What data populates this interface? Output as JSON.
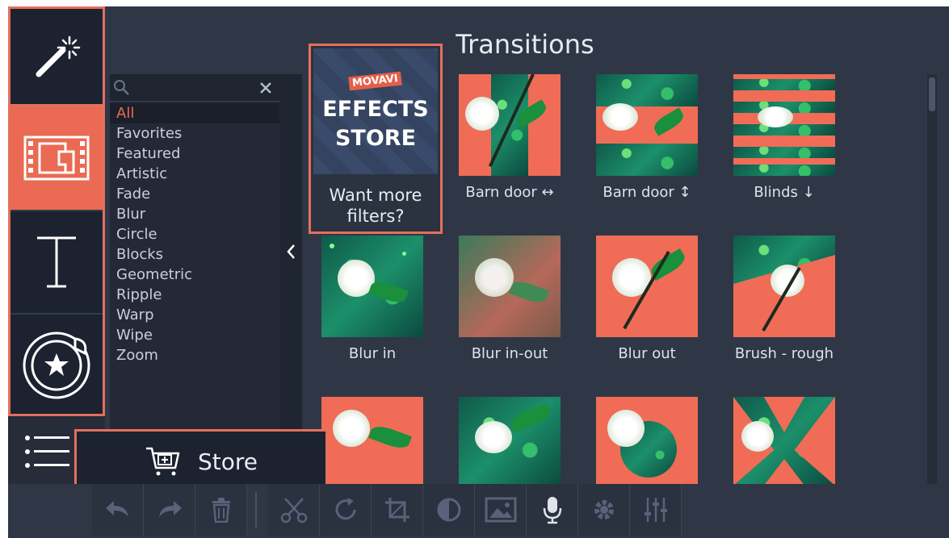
{
  "left_toolbar": {
    "tools": [
      {
        "name": "Magic wand",
        "icon": "magic-wand-icon"
      },
      {
        "name": "Filters",
        "icon": "filmstrip-icon",
        "active": true
      },
      {
        "name": "Titles",
        "icon": "text-icon"
      },
      {
        "name": "Stickers",
        "icon": "sticker-icon"
      }
    ],
    "menu_icon": "hamburger-menu-icon"
  },
  "categories": {
    "search_placeholder": "",
    "items": [
      "All",
      "Favorites",
      "Featured",
      "Artistic",
      "Fade",
      "Blur",
      "Circle",
      "Blocks",
      "Geometric",
      "Ripple",
      "Warp",
      "Wipe",
      "Zoom"
    ],
    "active_index": 0
  },
  "content": {
    "title": "Transitions",
    "store_card": {
      "brand": "MOVAVI",
      "line1": "EFFECTS",
      "line2": "STORE",
      "text": "Want more filters?"
    },
    "tiles": [
      {
        "label": "Barn door ↔"
      },
      {
        "label": "Barn door ↕"
      },
      {
        "label": "Blinds ↓"
      },
      {
        "label": "Blur in"
      },
      {
        "label": "Blur in-out"
      },
      {
        "label": "Blur out"
      },
      {
        "label": "Brush - rough"
      },
      {
        "label": ""
      },
      {
        "label": ""
      },
      {
        "label": ""
      },
      {
        "label": ""
      }
    ]
  },
  "store_button": {
    "label": "Store"
  },
  "bottom_toolbar": [
    "undo-icon",
    "redo-icon",
    "delete-icon",
    "cut-icon",
    "rotate-icon",
    "crop-icon",
    "color-adjust-icon",
    "image-icon",
    "microphone-icon",
    "settings-icon",
    "equalizer-icon"
  ],
  "colors": {
    "accent": "#e4705c",
    "panel": "#2f3747",
    "dark": "#1c2230"
  }
}
